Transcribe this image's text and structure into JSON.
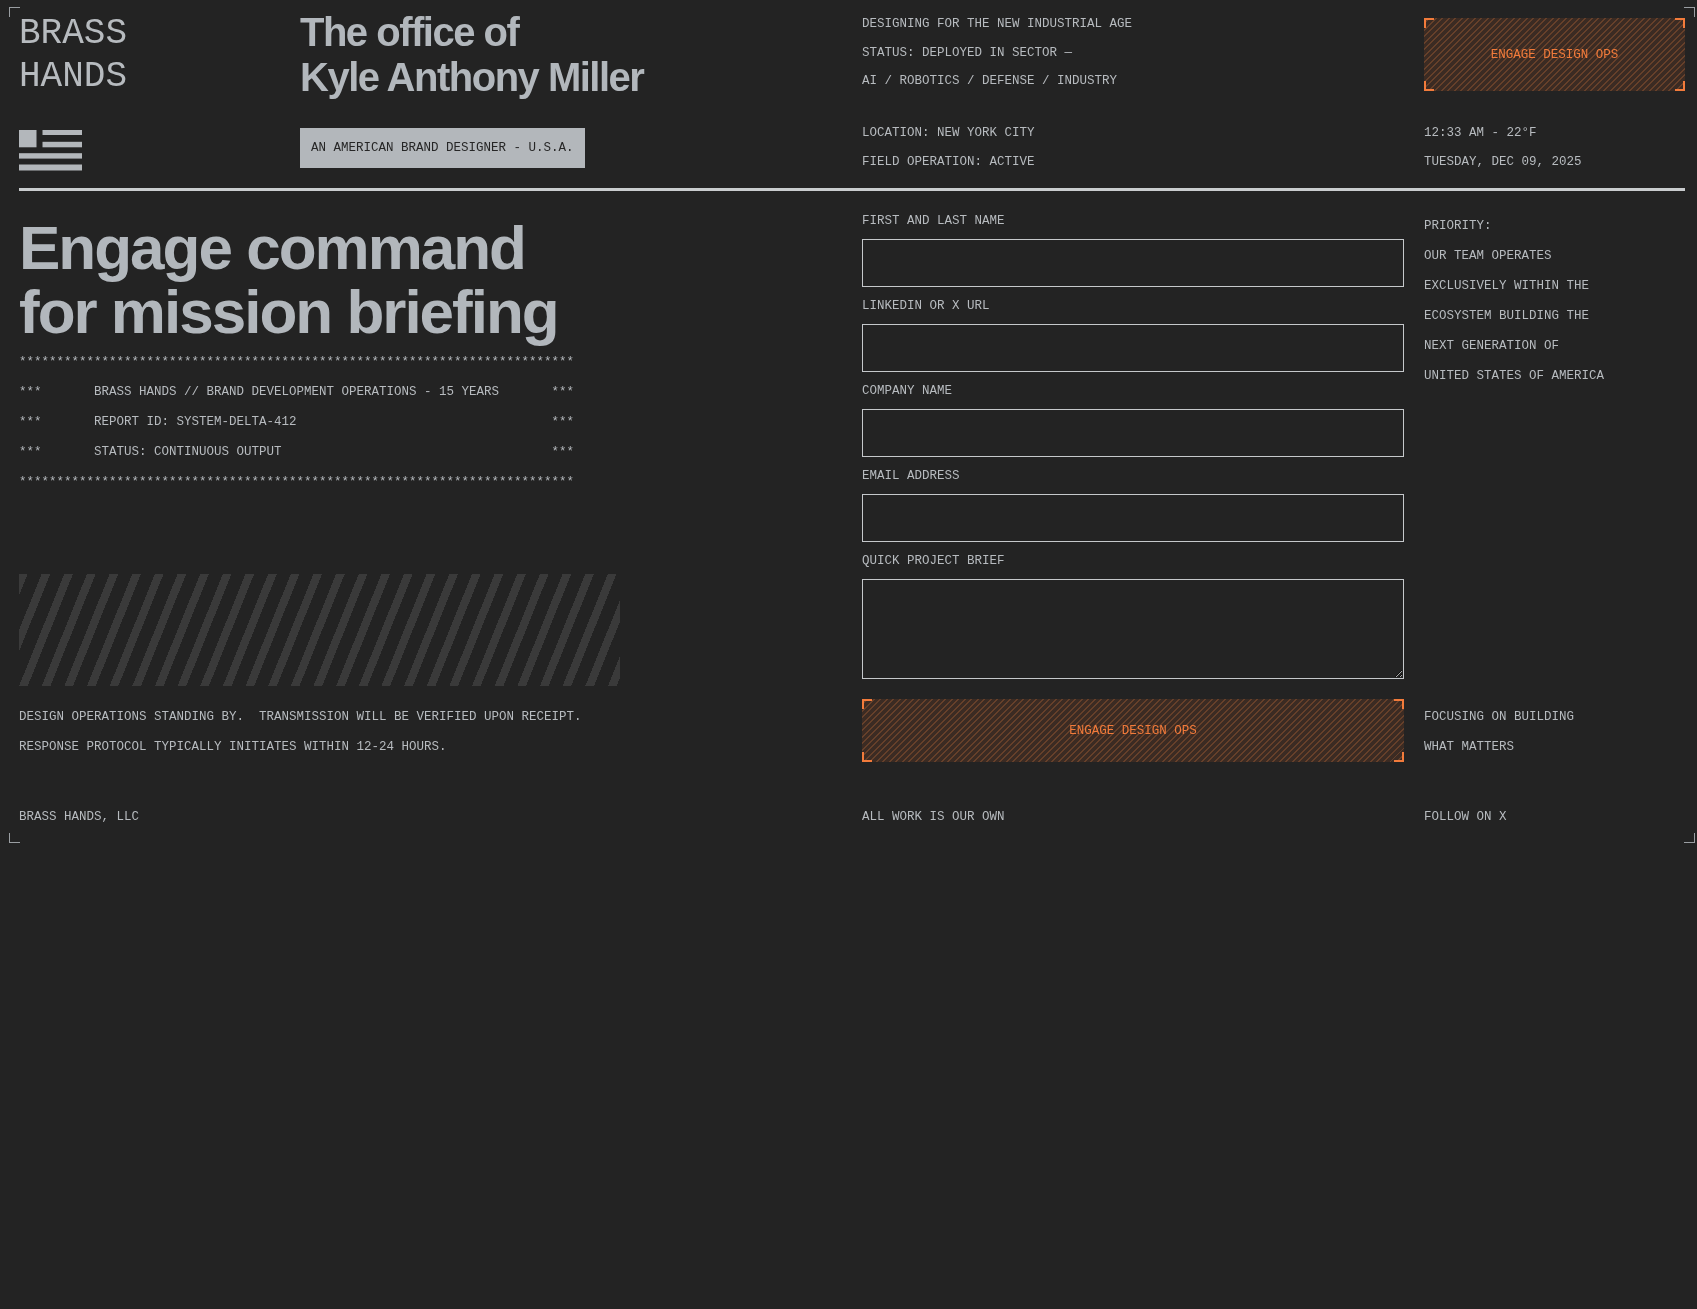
{
  "header": {
    "logo": "BRASS HANDS",
    "title_lines": [
      "The office of",
      "Kyle Anthony Miller"
    ],
    "badge": "AN AMERICAN BRAND DESIGNER - U.S.A.",
    "mission_lines": [
      "DESIGNING FOR THE NEW INDUSTRIAL AGE",
      "STATUS: DEPLOYED IN SECTOR —",
      "AI / ROBOTICS / DEFENSE / INDUSTRY"
    ],
    "field_lines": [
      "LOCATION: NEW YORK CITY",
      "FIELD OPERATION: ACTIVE"
    ],
    "cta_button": "ENGAGE DESIGN OPS",
    "time": "12:33 AM - 22°F",
    "date": "TUESDAY, DEC 09, 2025"
  },
  "briefing": {
    "heading_lines": [
      "Engage command",
      "for mission briefing"
    ],
    "report": {
      "rule_top": "**************************************************************************",
      "rows": [
        {
          "left": "***",
          "text": "BRASS HANDS // BRAND DEVELOPMENT OPERATIONS - 15 YEARS",
          "right": "***"
        },
        {
          "left": "***",
          "text": "REPORT ID: SYSTEM-DELTA-412",
          "right": "***"
        },
        {
          "left": "***",
          "text": "STATUS: CONTINUOUS OUTPUT",
          "right": "***"
        }
      ],
      "rule_bottom": "**************************************************************************"
    },
    "notice_lines": [
      "DESIGN OPERATIONS STANDING BY.  TRANSMISSION WILL BE VERIFIED UPON RECEIPT.",
      "RESPONSE PROTOCOL TYPICALLY INITIATES WITHIN 12-24 HOURS."
    ]
  },
  "form": {
    "fields": [
      {
        "label": "FIRST AND LAST NAME",
        "kind": "input"
      },
      {
        "label": "LINKEDIN OR X URL",
        "kind": "input"
      },
      {
        "label": "COMPANY NAME",
        "kind": "input"
      },
      {
        "label": "EMAIL ADDRESS",
        "kind": "input"
      },
      {
        "label": "QUICK PROJECT BRIEF",
        "kind": "textarea"
      }
    ],
    "submit_button": "ENGAGE DESIGN OPS"
  },
  "priority": {
    "label": "PRIORITY:",
    "lines": [
      "OUR TEAM OPERATES",
      "EXCLUSIVELY WITHIN THE",
      "ECOSYSTEM BUILDING THE",
      "NEXT GENERATION OF",
      "UNITED STATES OF AMERICA"
    ]
  },
  "focus_lines": [
    "FOCUSING ON BUILDING",
    "WHAT MATTERS"
  ],
  "footer": {
    "company": "BRASS HANDS, LLC",
    "note": "ALL WORK IS OUR OWN",
    "link": "FOLLOW ON X"
  }
}
